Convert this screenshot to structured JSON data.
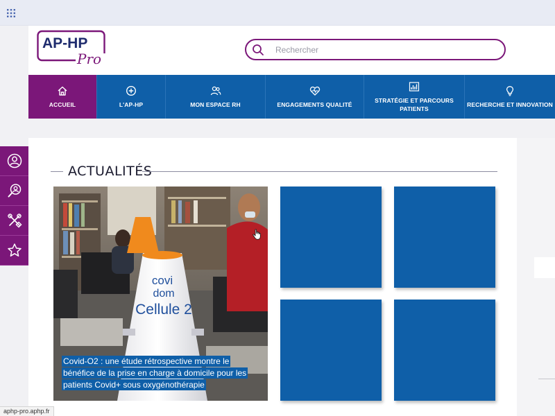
{
  "browser": {
    "status_url": "aphp-pro.aphp.fr",
    "apps_icon": "apps-grid-icon"
  },
  "header": {
    "logo": {
      "line1": "AP-HP",
      "line2": "Pro"
    },
    "search": {
      "placeholder": "Rechercher",
      "value": "",
      "icon": "search-icon"
    }
  },
  "nav": {
    "items": [
      {
        "label": "ACCUEIL",
        "icon": "home-icon",
        "active": true
      },
      {
        "label": "L'AP-HP",
        "icon": "plus-circle-icon",
        "active": false
      },
      {
        "label": "MON ESPACE RH",
        "icon": "users-icon",
        "active": false
      },
      {
        "label": "ENGAGEMENTS QUALITÉ",
        "icon": "heart-pulse-icon",
        "active": false
      },
      {
        "label": "STRATÉGIE ET PARCOURS PATIENTS",
        "icon": "strategy-chart-icon",
        "active": false
      },
      {
        "label": "RECHERCHE ET INNOVATION",
        "icon": "lightbulb-icon",
        "active": false
      }
    ]
  },
  "side_tools": [
    {
      "icon": "user-icon"
    },
    {
      "icon": "user-search-icon"
    },
    {
      "icon": "tools-icon"
    },
    {
      "icon": "star-icon"
    }
  ],
  "actualites": {
    "title": "ACTUALITÉS",
    "featured": {
      "caption": "Covid-O2 : une étude rétrospective montre le bénéfice de la prise en charge à domicile pour les patients Covid+ sous oxygénothérapie",
      "device_brand_1": "covi",
      "device_brand_2": "dom",
      "device_label": "Cellule 2"
    },
    "tiles_count": 4
  },
  "colors": {
    "brand_purple": "#7b1779",
    "brand_blue": "#0f5fa8",
    "tile_blue": "#0f5fa8"
  }
}
